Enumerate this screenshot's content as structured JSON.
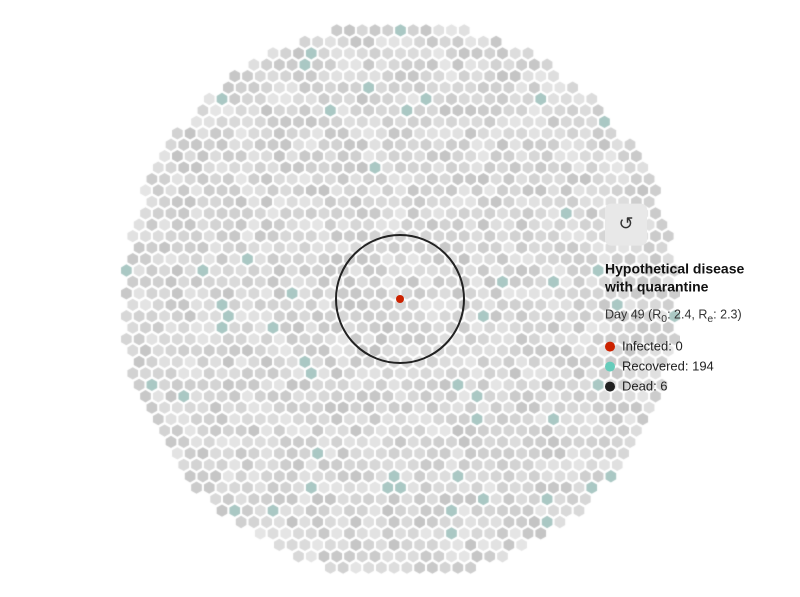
{
  "simulation": {
    "title_line1": "Hypothetical disease",
    "title_line2": "with quarantine",
    "day_info": "Day 49 (R₀: 2.4, Rₑ: 2.3)",
    "day_info_plain": "Day 49 (R",
    "day_label": "Day 49",
    "r0_label": "R",
    "r0_sub": "0",
    "r0_val": ": 2.4, R",
    "re_sub": "e",
    "re_val": ": 2.3)",
    "infected_label": "Infected: 0",
    "recovered_label": "Recovered: 194",
    "dead_label": "Dead: 6",
    "reset_icon": "↺",
    "colors": {
      "background": "#f0f0f0",
      "hex_default": "#d8d8d8",
      "hex_recovered": "#88cccc",
      "infected": "#cc2200",
      "recovered": "#66ccbb",
      "dead": "#222222"
    }
  }
}
